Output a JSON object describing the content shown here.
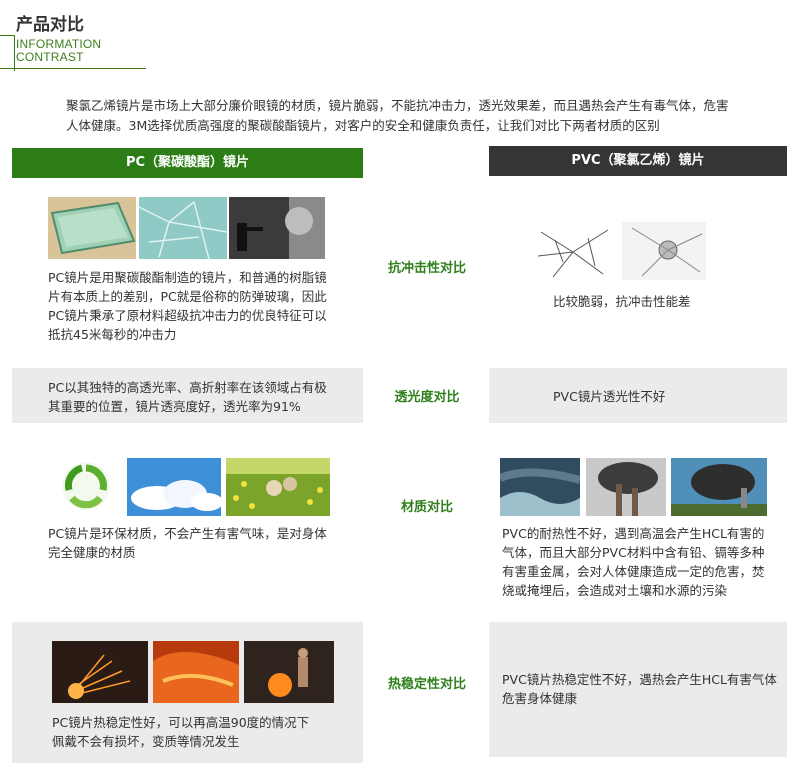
{
  "header": {
    "title": "产品对比",
    "subtitle_line1": "INFORMATION",
    "subtitle_line2": "CONTRAST"
  },
  "intro": {
    "line1": "聚氯乙烯镜片是市场上大部分廉价眼镜的材质，镜片脆弱，不能抗冲击力，透光效果差，而且遇热会产生有毒气体，危害",
    "line2": "人体健康。3M选择优质高强度的聚碳酸酯镜片，对客户的安全和健康负责任，让我们对比下两者材质的区别"
  },
  "columns": {
    "pc_header": "PC（聚碳酸酯）镜片",
    "pvc_header": "PVC（聚氯乙烯）镜片"
  },
  "rows": [
    {
      "label": "抗冲击性对比",
      "pc_lines": [
        "PC镜片是用聚碳酸酯制造的镜片，和普通的树脂镜",
        "片有本质上的差别，PC就是俗称的防弹玻璃，因此",
        "PC镜片秉承了原材料超级抗冲击力的优良特征可以",
        "抵抗45米每秒的冲击力"
      ],
      "pvc_lines": [
        "比较脆弱，抗冲击性能差"
      ]
    },
    {
      "label": "透光度对比",
      "pc_lines": [
        "PC以其独特的高透光率、高折射率在该领域占有极",
        "其重要的位置，镜片透亮度好，透光率为91%"
      ],
      "pvc_lines": [
        "PVC镜片透光性不好"
      ]
    },
    {
      "label": "材质对比",
      "pc_lines": [
        "PC镜片是环保材质，不会产生有害气味，是对身体",
        "完全健康的材质"
      ],
      "pvc_lines": [
        "PVC的耐热性不好，遇到高温会产生HCL有害的",
        "气体，而且大部分PVC材料中含有铅、镉等多种",
        "有害重金属，会对人体健康造成一定的危害，焚",
        "烧或掩埋后，会造成对土壤和水源的污染"
      ]
    },
    {
      "label": "热稳定性对比",
      "pc_lines": [
        "PC镜片热稳定性好，可以再高温90度的情况下",
        "佩戴不会有损坏，变质等情况发生"
      ],
      "pvc_lines": [
        "PVC镜片热稳定性不好，遇热会产生HCL有害气体",
        "危害身体健康"
      ]
    }
  ],
  "colors": {
    "accent_green": "#2c7d16",
    "label_green": "#2f7f1b",
    "dark_header": "#353535",
    "band_gray": "#ebebeb"
  }
}
